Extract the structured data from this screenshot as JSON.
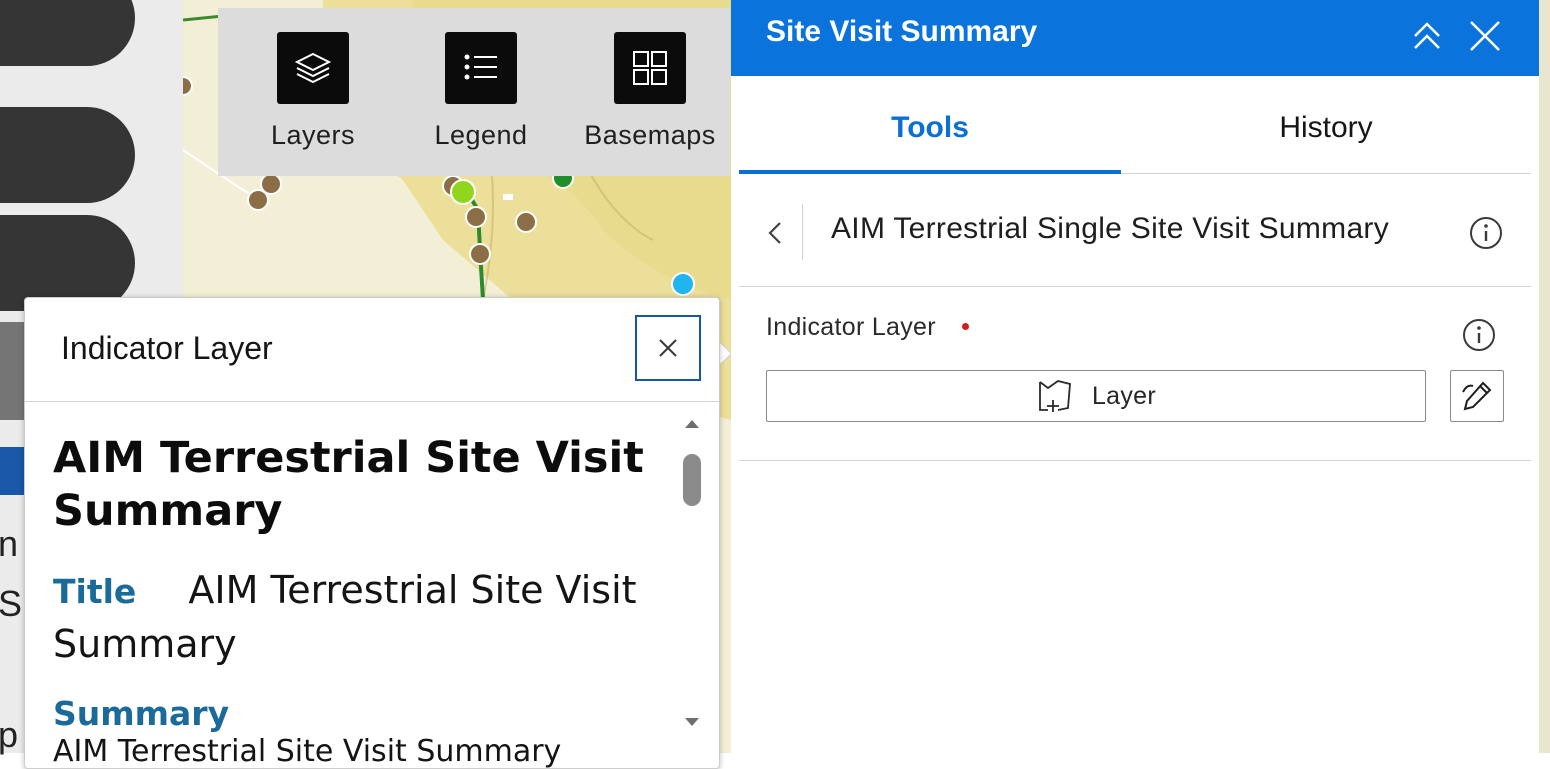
{
  "map_toolbar": {
    "tools": [
      {
        "label": "Layers",
        "icon": "layers-icon"
      },
      {
        "label": "Legend",
        "icon": "legend-list-icon"
      },
      {
        "label": "Basemaps",
        "icon": "basemap-grid-icon"
      }
    ]
  },
  "left_rail": {
    "partial_text_1": "n",
    "partial_text_2": "S",
    "partial_text_3": "p"
  },
  "popup": {
    "title": "Indicator Layer",
    "close_icon": "close-icon",
    "heading": "AIM Terrestrial Site Visit Summary",
    "fields": [
      {
        "label": "Title",
        "value": "AIM Terrestrial Site Visit Summary"
      },
      {
        "label": "Summary",
        "value": "AIM Terrestrial Site Visit Summary"
      }
    ]
  },
  "panel": {
    "title": "Site Visit Summary",
    "colors": {
      "header": "#0b74dc",
      "accent": "#0b6fd4",
      "required": "#d21c1c"
    },
    "tabs": [
      {
        "label": "Tools",
        "active": true
      },
      {
        "label": "History",
        "active": false
      }
    ],
    "tool_name": "AIM Terrestrial Single Site Visit Summary",
    "parameter": {
      "label": "Indicator Layer",
      "required": true,
      "button_label": "Layer"
    }
  }
}
